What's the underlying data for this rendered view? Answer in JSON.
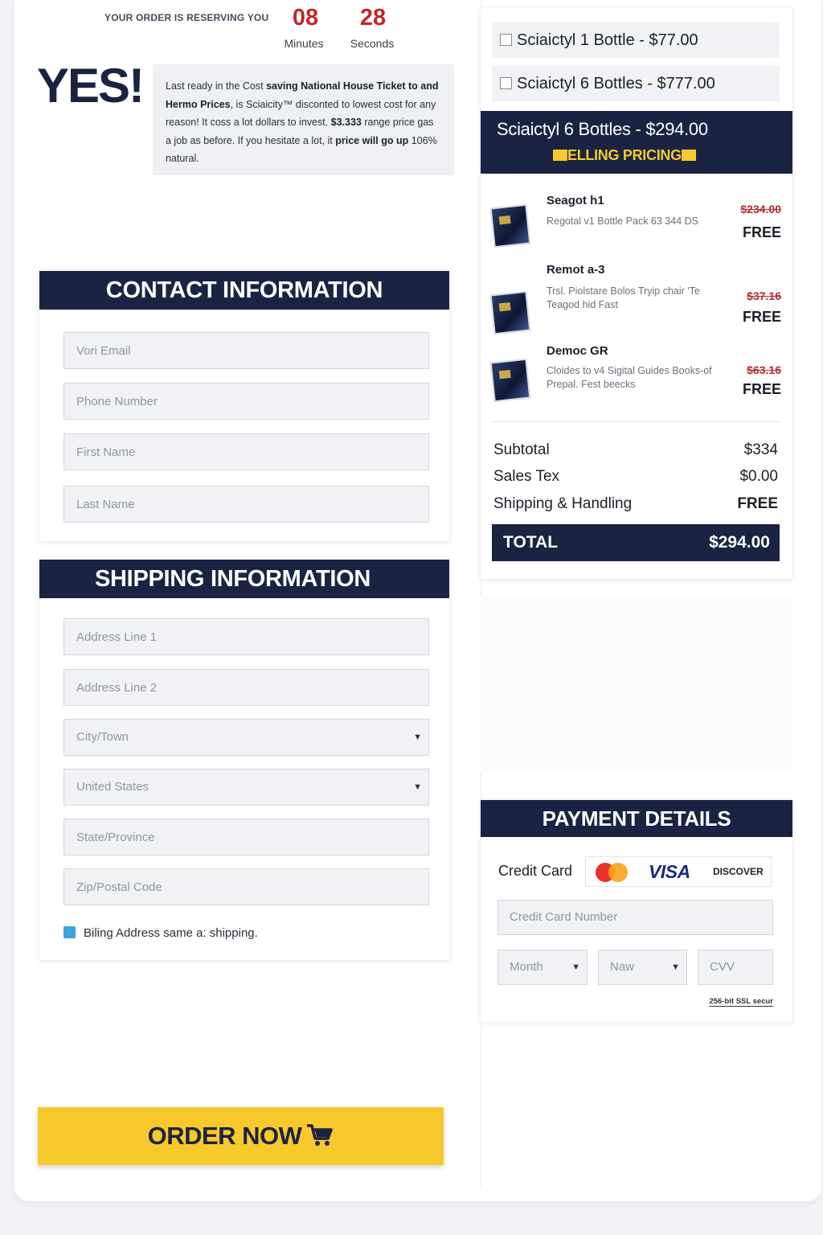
{
  "timer": {
    "label": "YOUR ORDER IS RESERVING YOU",
    "minutes": "08",
    "minutes_label": "Minutes",
    "seconds": "28",
    "seconds_label": "Seconds"
  },
  "promo": {
    "headline": "YES!",
    "t1": "Last ready in the Cost ",
    "b1": "saving National House Ticket to and Hermo Prices",
    "t2": ", is Sciaicity™ disconted to lowest cost for any reason! It coss a lot dollars to invest. ",
    "b2": "$3.333",
    "t3": " range price gas a job as before. If you hesitate a lot, it ",
    "b3": "price will go up",
    "t4": " 106% natural."
  },
  "contact": {
    "title": "CONTACT INFORMATION",
    "email_placeholder": "Vori Email",
    "phone_placeholder": "Phone Number",
    "first_placeholder": "First Name",
    "last_placeholder": "Last Name"
  },
  "shipping": {
    "title": "SHIPPING INFORMATION",
    "address1_placeholder": "Address Line 1",
    "address2_placeholder": "Address Line 2",
    "city_value": "City/Town",
    "country_value": "United States",
    "state_placeholder": "State/Province",
    "zip_placeholder": "Zip/Postal Code",
    "billing_same_label": "Biling Address same a: shipping."
  },
  "order_button": {
    "label": "ORDER NOW"
  },
  "summary": {
    "options": [
      {
        "label": "Sciaictyl 1 Bottle - $77.00"
      },
      {
        "label": "Sciaictyl 6 Bottles - $777.00"
      }
    ],
    "selected_title": "Sciaictyl 6 Bottles - $294.00",
    "selected_subtitle": "ELLING PRICING",
    "items": [
      {
        "name": "Seagot h1",
        "desc": "Regotal v1 Bottle Pack 63 344 DS",
        "old_price": "$234.00",
        "price": "FREE"
      },
      {
        "name": "Remot a-3",
        "desc": "Trsl. Piolstare Bolos Tryip chair 'Te Teagod hid Fast",
        "old_price": "$37.16",
        "price": "FREE"
      },
      {
        "name": "Democ GR",
        "desc": "Cloides to v4 Sigital Guides Books-of Prepal. Fest beecks",
        "old_price": "$63.16",
        "price": "FREE"
      }
    ],
    "subtotal_label": "Subtotal",
    "subtotal_value": "$334",
    "tax_label": "Sales Tex",
    "tax_value": "$0.00",
    "shipping_label": "Shipping & Handling",
    "shipping_value": "FREE",
    "total_label": "TOTAL",
    "total_value": "$294.00"
  },
  "payment": {
    "title": "PAYMENT DETAILS",
    "cc_label": "Credit Card",
    "visa_text": "VISA",
    "discover_text": "DISCOVER",
    "card_number_placeholder": "Credit Card Number",
    "month_value": "Month",
    "year_value": "Naw",
    "cvv_placeholder": "CVV",
    "ssl_text": "256-bit SSL secur"
  },
  "colors": {
    "navy": "#1b2342",
    "accent_yellow": "#f7c92c",
    "timer_red": "#c0272d",
    "strike_red": "#b52a2f",
    "checkbox_blue": "#3aa5d8"
  }
}
